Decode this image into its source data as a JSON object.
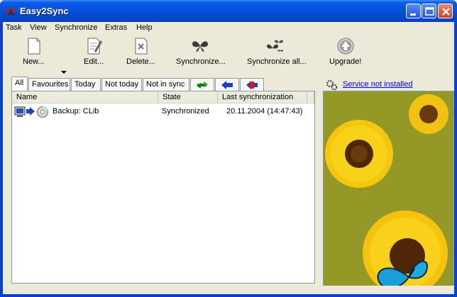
{
  "window": {
    "title": "Easy2Sync"
  },
  "menu": [
    {
      "label": "Task"
    },
    {
      "label": "View"
    },
    {
      "label": "Synchronize"
    },
    {
      "label": "Extras"
    },
    {
      "label": "Help"
    }
  ],
  "toolbar": {
    "new_label": "New...",
    "edit_label": "Edit...",
    "delete_label": "Delete...",
    "synchronize_label": "Synchronize...",
    "synchronize_all_label": "Synchronize all...",
    "upgrade_label": "Upgrade!"
  },
  "tabs": [
    {
      "label": "All",
      "active": true
    },
    {
      "label": "Favourites"
    },
    {
      "label": "Today"
    },
    {
      "label": "Not today"
    },
    {
      "label": "Not in sync"
    }
  ],
  "list": {
    "columns": [
      "Name",
      "State",
      "Last synchronization"
    ],
    "rows": [
      {
        "name": "Backup: CLib",
        "state": "Synchronized",
        "last_sync": "20.11.2004 (14:47:43)"
      }
    ]
  },
  "service": {
    "status_text": "Service not installed"
  },
  "colors": {
    "accent": "#0a5ce8",
    "face": "#ece9d8",
    "link": "#0000ee"
  }
}
